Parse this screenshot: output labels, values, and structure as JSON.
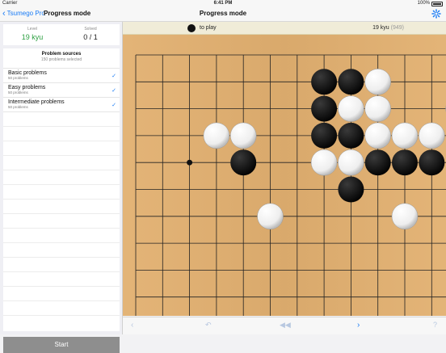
{
  "status": {
    "carrier": "Carrier",
    "time": "6:41 PM",
    "battery": "100%"
  },
  "nav": {
    "back_label": "Tsumego Pro",
    "left_title": "Progress mode",
    "center_title": "Progress mode"
  },
  "stats": {
    "level_label": "Level",
    "level_value": "19 kyu",
    "solved_label": "Solved",
    "solved_value": "0 / 1"
  },
  "sources": {
    "title": "Problem sources",
    "subtitle": "150 problems selected",
    "items": [
      {
        "name": "Basic problems",
        "count": "50 problems",
        "checked": "✓"
      },
      {
        "name": "Easy problems",
        "count": "50 problems",
        "checked": "✓"
      },
      {
        "name": "Intermediate problems",
        "count": "50 problems",
        "checked": "✓"
      }
    ]
  },
  "start_label": "Start",
  "infobar": {
    "to_play": "to play",
    "rank": "19 kyu",
    "rank_points": "(949)"
  },
  "board": {
    "size": "19x19 (partial view)",
    "black": [
      [
        7,
        1
      ],
      [
        8,
        1
      ],
      [
        7,
        2
      ],
      [
        7,
        3
      ],
      [
        8,
        3
      ],
      [
        4,
        4
      ],
      [
        9,
        4
      ],
      [
        10,
        4
      ],
      [
        11,
        4
      ],
      [
        8,
        5
      ]
    ],
    "white": [
      [
        9,
        1
      ],
      [
        8,
        2
      ],
      [
        9,
        2
      ],
      [
        12,
        2
      ],
      [
        3,
        3
      ],
      [
        4,
        3
      ],
      [
        9,
        3
      ],
      [
        10,
        3
      ],
      [
        11,
        3
      ],
      [
        7,
        4
      ],
      [
        8,
        4
      ],
      [
        5,
        6
      ],
      [
        10,
        6
      ]
    ],
    "hoshi": [
      [
        2,
        4
      ],
      [
        8,
        4
      ],
      [
        2,
        10
      ],
      [
        8,
        10
      ]
    ]
  },
  "bottom": {
    "prev": "‹",
    "undo": "↶",
    "rewind": "◀◀",
    "next": "›",
    "hint": "?"
  }
}
